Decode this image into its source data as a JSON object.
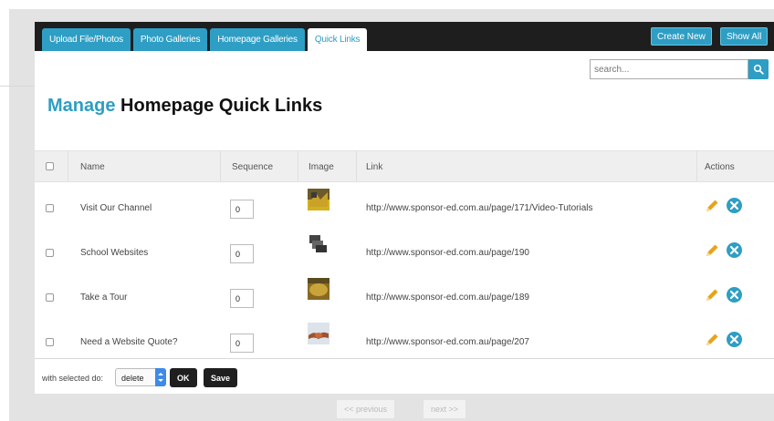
{
  "tabs": [
    {
      "label": "Upload File/Photos",
      "active": false
    },
    {
      "label": "Photo Galleries",
      "active": false
    },
    {
      "label": "Homepage Galleries",
      "active": false
    },
    {
      "label": "Quick Links",
      "active": true
    }
  ],
  "actions": {
    "create_new": "Create New",
    "show_all": "Show All"
  },
  "search": {
    "placeholder": "search...",
    "value": ""
  },
  "title": {
    "accent": "Manage",
    "rest": "Homepage Quick Links"
  },
  "table": {
    "columns": [
      "Name",
      "Sequence",
      "Image",
      "Link",
      "Actions"
    ],
    "rows": [
      {
        "name": "Visit Our Channel",
        "sequence": "0",
        "link": "http://www.sponsor-ed.com.au/page/171/Video-Tutorials"
      },
      {
        "name": "School Websites",
        "sequence": "0",
        "link": "http://www.sponsor-ed.com.au/page/190"
      },
      {
        "name": "Take a Tour",
        "sequence": "0",
        "link": "http://www.sponsor-ed.com.au/page/189"
      },
      {
        "name": "Need a Website Quote?",
        "sequence": "0",
        "link": "http://www.sponsor-ed.com.au/page/207"
      }
    ]
  },
  "bulk": {
    "label": "with selected do:",
    "selected_option": "delete",
    "ok_label": "OK",
    "save_label": "Save"
  },
  "pagination": {
    "previous": "<< previous",
    "next": "next >>"
  },
  "colors": {
    "accent": "#2e9ec4",
    "topbar": "#1e1e1e",
    "edit_icon": "#e8a317",
    "delete_icon": "#2e9ec4"
  },
  "icons": [
    "search-icon",
    "edit-pencil-icon",
    "delete-circle-icon"
  ]
}
